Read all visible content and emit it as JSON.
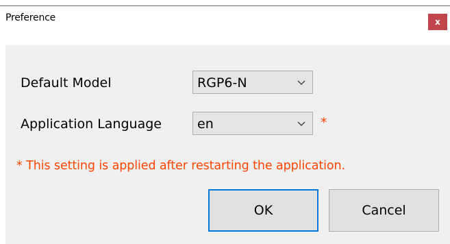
{
  "window": {
    "title": "Preference",
    "close_label": "x"
  },
  "form": {
    "default_model": {
      "label": "Default Model",
      "value": "RGP6-N"
    },
    "application_language": {
      "label": "Application Language",
      "value": "en",
      "required_mark": "*"
    },
    "note": "* This setting is applied after restarting the application."
  },
  "buttons": {
    "ok_label": "OK",
    "cancel_label": "Cancel"
  },
  "colors": {
    "accent": "#0078d7",
    "close_bg": "#c1464b",
    "warning": "#ff4500",
    "client_bg": "#f0f0f0"
  },
  "icons": {
    "close": "close-icon",
    "dropdown": "chevron-down-icon"
  }
}
